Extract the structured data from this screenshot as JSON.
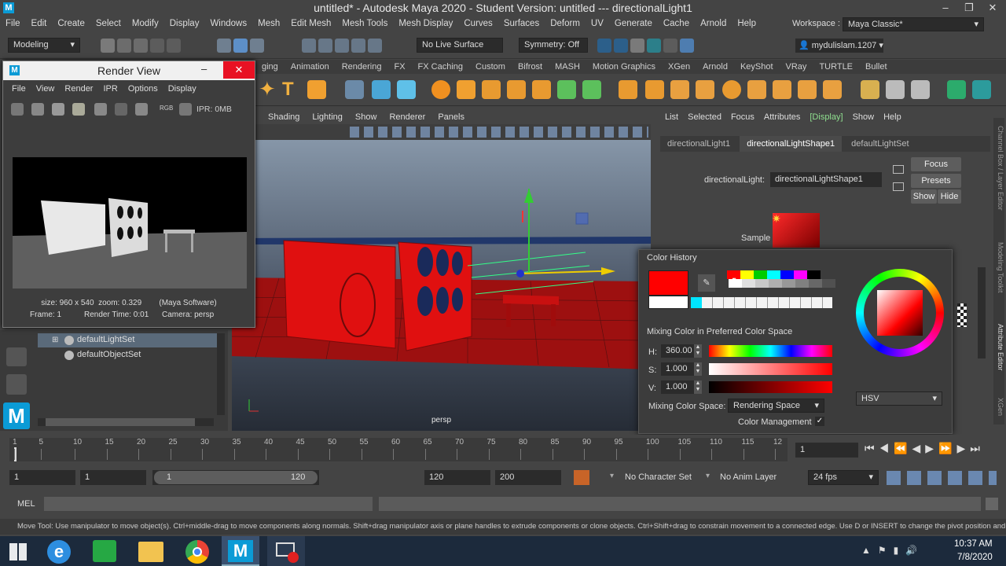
{
  "window": {
    "title": "untitled* - Autodesk Maya 2020 - Student Version: untitled   ---   directionalLight1"
  },
  "menubar": [
    "File",
    "Edit",
    "Create",
    "Select",
    "Modify",
    "Display",
    "Windows",
    "Mesh",
    "Edit Mesh",
    "Mesh Tools",
    "Mesh Display",
    "Curves",
    "Surfaces",
    "Deform",
    "UV",
    "Generate",
    "Cache",
    "Arnold",
    "Help"
  ],
  "workspace": {
    "label": "Workspace :",
    "value": "Maya Classic*"
  },
  "status": {
    "mode": "Modeling",
    "live_surface": "No Live Surface",
    "symmetry": "Symmetry: Off",
    "user": "mydulislam.1207"
  },
  "shelf_tabs": [
    "ging",
    "Animation",
    "Rendering",
    "FX",
    "FX Caching",
    "Custom",
    "Bifrost",
    "MASH",
    "Motion Graphics",
    "XGen",
    "Arnold",
    "KeyShot",
    "VRay",
    "TURTLE",
    "Bullet"
  ],
  "viewport": {
    "menus": [
      "Shading",
      "Lighting",
      "Show",
      "Renderer",
      "Panels"
    ],
    "camera_label": "persp"
  },
  "render_view": {
    "title": "Render View",
    "menus": [
      "File",
      "View",
      "Render",
      "IPR",
      "Options",
      "Display"
    ],
    "ipr_label": "IPR: 0MB",
    "rgb_label": "RGB",
    "info_line1": "size: 960 x 540  zoom: 0.329        (Maya Software)",
    "frame": "Frame: 1",
    "render_time": "Render Time: 0:01",
    "camera": "Camera: persp"
  },
  "outliner": {
    "items": [
      "defaultLightSet",
      "defaultObjectSet"
    ]
  },
  "attribute_editor": {
    "menus": [
      "List",
      "Selected",
      "Focus",
      "Attributes",
      "[Display]",
      "Show",
      "Help"
    ],
    "tabs": [
      "directionalLight1",
      "directionalLightShape1",
      "defaultLightSet"
    ],
    "field_label": "directionalLight:",
    "field_value": "directionalLightShape1",
    "buttons": {
      "focus": "Focus",
      "presets": "Presets",
      "show": "Show",
      "hide": "Hide"
    },
    "sample_label": "Sample",
    "side_tabs": [
      "Channel Box / Layer Editor",
      "Modeling Toolkit",
      "Attribute Editor",
      "XGen"
    ]
  },
  "color_picker": {
    "history_label": "Color History",
    "mixing_label": "Mixing Color in Preferred Color Space",
    "h_label": "H:",
    "h_value": "360.00",
    "s_label": "S:",
    "s_value": "1.000",
    "v_label": "V:",
    "v_value": "1.000",
    "space_label": "Mixing Color Space:",
    "space_value": "Rendering Space",
    "mgmt_label": "Color Management",
    "mgmt_check": "✓",
    "mode": "HSV",
    "history_colors": [
      "#ff0000",
      "#ffff00",
      "#00cc00",
      "#00ffff",
      "#0000ff",
      "#ff00ff",
      "#000000",
      "#ffffff",
      "#e0e0e0",
      "#c8c8c8",
      "#b0b0b0",
      "#989898",
      "#808080",
      "#686868",
      "#505050"
    ],
    "accent": "#ff0000"
  },
  "timeline": {
    "ticks": [
      "1",
      "5",
      "10",
      "15",
      "20",
      "25",
      "30",
      "35",
      "40",
      "45",
      "50",
      "55",
      "60",
      "65",
      "70",
      "75",
      "80",
      "85",
      "90",
      "95",
      "100",
      "105",
      "110",
      "115",
      "12"
    ],
    "current_frame": "1"
  },
  "range": {
    "start": "1",
    "start2": "1",
    "slider_start": "1",
    "slider_end": "120",
    "end": "120",
    "end2": "200",
    "character": "No Character Set",
    "anim_layer": "No Anim Layer",
    "fps": "24 fps"
  },
  "cmdline": {
    "label": "MEL"
  },
  "helpline": "Move Tool: Use manipulator to move object(s). Ctrl+middle-drag to move components along normals. Shift+drag manipulator axis or plane handles to extrude components or clone objects. Ctrl+Shift+drag to constrain movement to a connected edge. Use D or INSERT to change the pivot position and ax",
  "taskbar": {
    "time": "10:37 AM",
    "date": "7/8/2020"
  }
}
